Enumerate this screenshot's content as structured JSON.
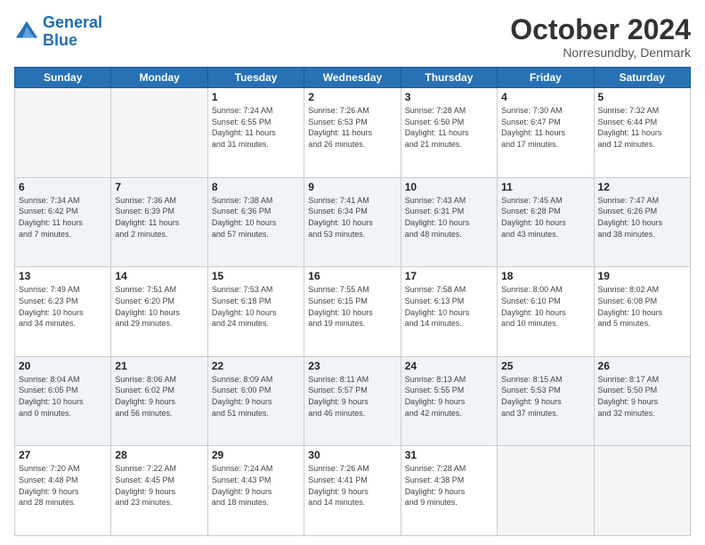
{
  "header": {
    "logo_line1": "General",
    "logo_line2": "Blue",
    "month": "October 2024",
    "location": "Norresundby, Denmark"
  },
  "days_of_week": [
    "Sunday",
    "Monday",
    "Tuesday",
    "Wednesday",
    "Thursday",
    "Friday",
    "Saturday"
  ],
  "weeks": [
    [
      {
        "day": "",
        "info": ""
      },
      {
        "day": "",
        "info": ""
      },
      {
        "day": "1",
        "info": "Sunrise: 7:24 AM\nSunset: 6:55 PM\nDaylight: 11 hours\nand 31 minutes."
      },
      {
        "day": "2",
        "info": "Sunrise: 7:26 AM\nSunset: 6:53 PM\nDaylight: 11 hours\nand 26 minutes."
      },
      {
        "day": "3",
        "info": "Sunrise: 7:28 AM\nSunset: 6:50 PM\nDaylight: 11 hours\nand 21 minutes."
      },
      {
        "day": "4",
        "info": "Sunrise: 7:30 AM\nSunset: 6:47 PM\nDaylight: 11 hours\nand 17 minutes."
      },
      {
        "day": "5",
        "info": "Sunrise: 7:32 AM\nSunset: 6:44 PM\nDaylight: 11 hours\nand 12 minutes."
      }
    ],
    [
      {
        "day": "6",
        "info": "Sunrise: 7:34 AM\nSunset: 6:42 PM\nDaylight: 11 hours\nand 7 minutes."
      },
      {
        "day": "7",
        "info": "Sunrise: 7:36 AM\nSunset: 6:39 PM\nDaylight: 11 hours\nand 2 minutes."
      },
      {
        "day": "8",
        "info": "Sunrise: 7:38 AM\nSunset: 6:36 PM\nDaylight: 10 hours\nand 57 minutes."
      },
      {
        "day": "9",
        "info": "Sunrise: 7:41 AM\nSunset: 6:34 PM\nDaylight: 10 hours\nand 53 minutes."
      },
      {
        "day": "10",
        "info": "Sunrise: 7:43 AM\nSunset: 6:31 PM\nDaylight: 10 hours\nand 48 minutes."
      },
      {
        "day": "11",
        "info": "Sunrise: 7:45 AM\nSunset: 6:28 PM\nDaylight: 10 hours\nand 43 minutes."
      },
      {
        "day": "12",
        "info": "Sunrise: 7:47 AM\nSunset: 6:26 PM\nDaylight: 10 hours\nand 38 minutes."
      }
    ],
    [
      {
        "day": "13",
        "info": "Sunrise: 7:49 AM\nSunset: 6:23 PM\nDaylight: 10 hours\nand 34 minutes."
      },
      {
        "day": "14",
        "info": "Sunrise: 7:51 AM\nSunset: 6:20 PM\nDaylight: 10 hours\nand 29 minutes."
      },
      {
        "day": "15",
        "info": "Sunrise: 7:53 AM\nSunset: 6:18 PM\nDaylight: 10 hours\nand 24 minutes."
      },
      {
        "day": "16",
        "info": "Sunrise: 7:55 AM\nSunset: 6:15 PM\nDaylight: 10 hours\nand 19 minutes."
      },
      {
        "day": "17",
        "info": "Sunrise: 7:58 AM\nSunset: 6:13 PM\nDaylight: 10 hours\nand 14 minutes."
      },
      {
        "day": "18",
        "info": "Sunrise: 8:00 AM\nSunset: 6:10 PM\nDaylight: 10 hours\nand 10 minutes."
      },
      {
        "day": "19",
        "info": "Sunrise: 8:02 AM\nSunset: 6:08 PM\nDaylight: 10 hours\nand 5 minutes."
      }
    ],
    [
      {
        "day": "20",
        "info": "Sunrise: 8:04 AM\nSunset: 6:05 PM\nDaylight: 10 hours\nand 0 minutes."
      },
      {
        "day": "21",
        "info": "Sunrise: 8:06 AM\nSunset: 6:02 PM\nDaylight: 9 hours\nand 56 minutes."
      },
      {
        "day": "22",
        "info": "Sunrise: 8:09 AM\nSunset: 6:00 PM\nDaylight: 9 hours\nand 51 minutes."
      },
      {
        "day": "23",
        "info": "Sunrise: 8:11 AM\nSunset: 5:57 PM\nDaylight: 9 hours\nand 46 minutes."
      },
      {
        "day": "24",
        "info": "Sunrise: 8:13 AM\nSunset: 5:55 PM\nDaylight: 9 hours\nand 42 minutes."
      },
      {
        "day": "25",
        "info": "Sunrise: 8:15 AM\nSunset: 5:53 PM\nDaylight: 9 hours\nand 37 minutes."
      },
      {
        "day": "26",
        "info": "Sunrise: 8:17 AM\nSunset: 5:50 PM\nDaylight: 9 hours\nand 32 minutes."
      }
    ],
    [
      {
        "day": "27",
        "info": "Sunrise: 7:20 AM\nSunset: 4:48 PM\nDaylight: 9 hours\nand 28 minutes."
      },
      {
        "day": "28",
        "info": "Sunrise: 7:22 AM\nSunset: 4:45 PM\nDaylight: 9 hours\nand 23 minutes."
      },
      {
        "day": "29",
        "info": "Sunrise: 7:24 AM\nSunset: 4:43 PM\nDaylight: 9 hours\nand 18 minutes."
      },
      {
        "day": "30",
        "info": "Sunrise: 7:26 AM\nSunset: 4:41 PM\nDaylight: 9 hours\nand 14 minutes."
      },
      {
        "day": "31",
        "info": "Sunrise: 7:28 AM\nSunset: 4:38 PM\nDaylight: 9 hours\nand 9 minutes."
      },
      {
        "day": "",
        "info": ""
      },
      {
        "day": "",
        "info": ""
      }
    ]
  ]
}
